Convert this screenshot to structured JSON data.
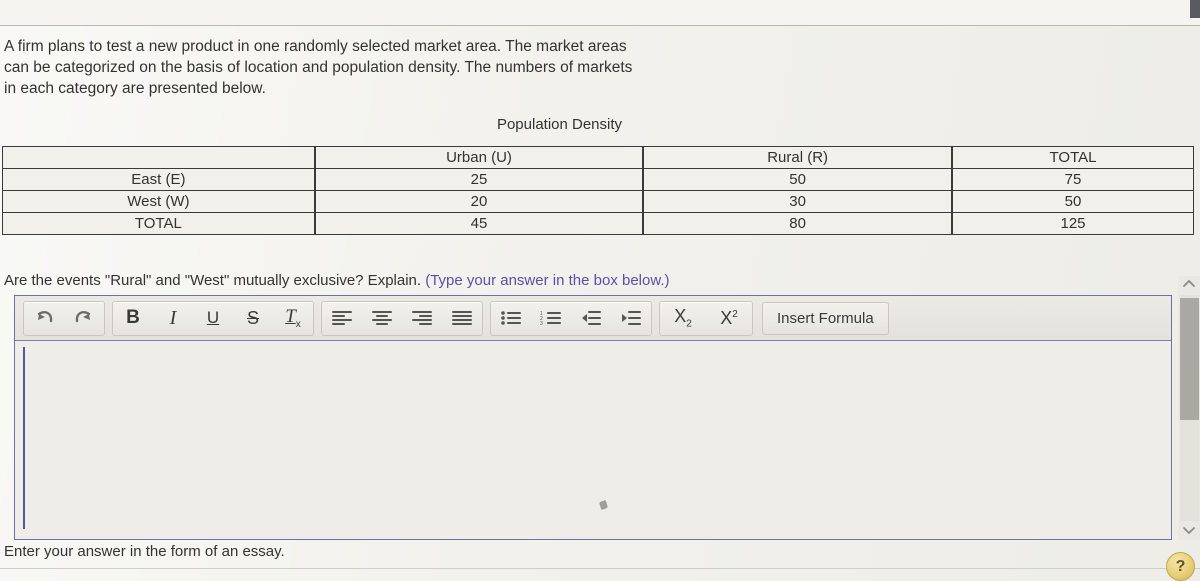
{
  "prompt": {
    "text": "A firm plans to test a new product in one randomly selected market area. The market areas can be categorized on the basis of location and population density. The numbers of markets in each category are presented below."
  },
  "table": {
    "caption": "Population Density",
    "headers": [
      "",
      "Urban (U)",
      "Rural (R)",
      "TOTAL"
    ],
    "rows": [
      {
        "label": "East (E)",
        "urban": "25",
        "rural": "50",
        "total": "75"
      },
      {
        "label": "West (W)",
        "urban": "20",
        "rural": "30",
        "total": "50"
      },
      {
        "label": "TOTAL",
        "urban": "45",
        "rural": "80",
        "total": "125"
      }
    ]
  },
  "question": {
    "text": "Are the events \"Rural\" and \"West\" mutually exclusive? Explain. ",
    "hint": "(Type your answer in the box below.)",
    "hint_color": "#5b4fa8"
  },
  "editor": {
    "toolbar": {
      "history": [
        {
          "icon": "undo-icon",
          "label": "Undo"
        },
        {
          "icon": "redo-icon",
          "label": "Redo"
        }
      ],
      "format": [
        {
          "icon": "bold-icon",
          "label": "B"
        },
        {
          "icon": "italic-icon",
          "label": "I"
        },
        {
          "icon": "underline-icon",
          "label": "U"
        },
        {
          "icon": "strikethrough-icon",
          "label": "S"
        },
        {
          "icon": "clear-format-icon",
          "label": "Tx"
        }
      ],
      "align": [
        {
          "icon": "align-left-icon",
          "label": "Align left"
        },
        {
          "icon": "align-center-icon",
          "label": "Align center"
        },
        {
          "icon": "align-right-icon",
          "label": "Align right"
        },
        {
          "icon": "align-justify-icon",
          "label": "Justify"
        }
      ],
      "lists": [
        {
          "icon": "bulleted-list-icon",
          "label": "Bulleted list"
        },
        {
          "icon": "numbered-list-icon",
          "label": "Numbered list"
        },
        {
          "icon": "outdent-icon",
          "label": "Decrease indent"
        },
        {
          "icon": "indent-icon",
          "label": "Increase indent"
        }
      ],
      "script": [
        {
          "icon": "subscript-icon",
          "label": "X2"
        },
        {
          "icon": "superscript-icon",
          "label": "X2"
        }
      ],
      "insert_formula_label": "Insert Formula"
    },
    "body_value": "",
    "border_color": "#6f6fa8"
  },
  "scrollbar": {
    "up_icon": "chevron-up-icon",
    "down_icon": "chevron-down-icon"
  },
  "footer": {
    "instruction": "Enter your answer in the form of an essay."
  },
  "help": {
    "label": "?",
    "icon": "help-icon"
  }
}
